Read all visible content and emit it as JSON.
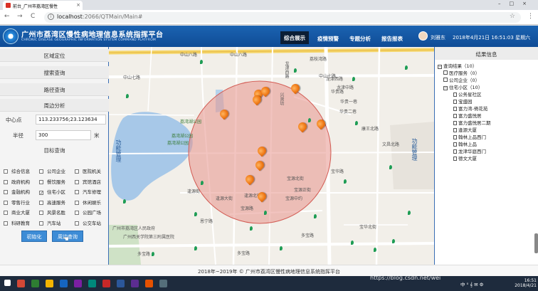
{
  "browser": {
    "tab_title": "前台_广州市荔湾区慢性",
    "tab_close": "×",
    "url_host": "localhost",
    "url_path": ":2066/QTMain/Main#",
    "back": "←",
    "forward": "→",
    "reload": "C",
    "window_controls": "–□×",
    "star": "☆",
    "menu": "⋮",
    "info": "i"
  },
  "header": {
    "title": "广州市荔湾区慢性病地理信息系统指挥平台",
    "subtitle": "CHRONIC DISEASE GEOGRAPHIC INFORMATION SYSTEM COMMAND PLATFROM",
    "nav": [
      "综合展示",
      "疫情预警",
      "专题分析",
      "报告报表"
    ],
    "user": "刘雅东",
    "datetime": "2018年4月21日 16:51:03 星期六"
  },
  "left_panel": {
    "sections": [
      "区域定位",
      "搜索查询",
      "路径查询",
      "周边分析"
    ],
    "center_label": "中心点",
    "center_value": "113.233756;23.123634",
    "radius_label": "半径",
    "radius_value": "300",
    "unit": "米",
    "target_label": "目标查询",
    "checkboxes": [
      {
        "label": "综合信息",
        "checked": false
      },
      {
        "label": "公司企业",
        "checked": false
      },
      {
        "label": "医院机关",
        "checked": false
      },
      {
        "label": "政府机构",
        "checked": false
      },
      {
        "label": "餐饮服务",
        "checked": false
      },
      {
        "label": "宾馆酒店",
        "checked": false
      },
      {
        "label": "金融机构",
        "checked": false
      },
      {
        "label": "住宅小区",
        "checked": true
      },
      {
        "label": "汽车修理",
        "checked": false
      },
      {
        "label": "零售行业",
        "checked": false
      },
      {
        "label": "高速服务",
        "checked": false
      },
      {
        "label": "休闲娱乐",
        "checked": false
      },
      {
        "label": "商业大厦",
        "checked": false
      },
      {
        "label": "风景名胜",
        "checked": false
      },
      {
        "label": "公园广场",
        "checked": false
      },
      {
        "label": "科研教育",
        "checked": false
      },
      {
        "label": "汽车站",
        "checked": false
      },
      {
        "label": "公交车站",
        "checked": false
      }
    ],
    "btn_init": "初始化",
    "btn_search": "周边查询",
    "check_mark": "✓"
  },
  "map": {
    "labels": [
      "中山八路",
      "中山八路",
      "中山七路",
      "中山七路",
      "龙津西路",
      "龙津中路",
      "龙津西路",
      "逢源大街",
      "逢源北街",
      "逢源街",
      "荔湾湖公园",
      "荔湾湖公园",
      "宝源北街",
      "宝源正街",
      "宝源中约",
      "宝源路",
      "宝华路",
      "多宝路",
      "多宝路",
      "多宝路",
      "恩宁路",
      "康王北路",
      "华贵路",
      "华贵一巷",
      "华贵二巷",
      "文昌北路",
      "兴贤坊",
      "荔枝湾路",
      "功能管理",
      "功能管理",
      "广州市荔湾区人民政府",
      "广州西关学院第三附属医院",
      "宝华北街",
      "荔湾湖公园"
    ]
  },
  "right_panel": {
    "head": "结果信息",
    "root": "查询结果（10）",
    "groups": [
      "医疗服务（0）",
      "公司企业（0）",
      "住宅小区（10）"
    ],
    "items": [
      "公务星社区",
      "宝盛园",
      "富力湾-倚花苑",
      "富力盛悦居",
      "富力盛悦居二期",
      "逢源大厦",
      "翰林上品西门",
      "翰林上品",
      "龙津华庭西门",
      "德文大厦"
    ],
    "expand": "−"
  },
  "footer": {
    "text": "2018年~2019年 © 广州市荔湾区慢性病地理信息系统指挥平台"
  },
  "taskbar": {
    "watermark": "https://blog.csdn.net/wei",
    "time": "16:51",
    "date": "2018/4/21",
    "tray": "中 ⁰ 𝄞 ✉ ⚙"
  },
  "colors": {
    "header": "#1b63b1",
    "circle": "#e8938c",
    "marker": "#f07a17",
    "active_nav": "#0b1e35"
  }
}
